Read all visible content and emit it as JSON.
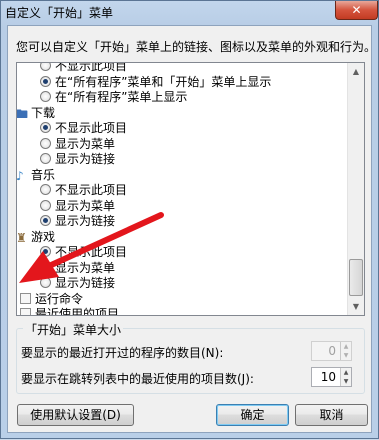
{
  "window": {
    "title": "自定义「开始」菜单",
    "close_label": "✕"
  },
  "intro_text": "您可以自定义「开始」菜单上的链接、图标以及菜单的外观和行为。",
  "list": {
    "rows": [
      {
        "kind": "radio",
        "label": "不显示此项目",
        "checked": false
      },
      {
        "kind": "radio",
        "label": "在“所有程序”菜单和「开始」菜单上显示",
        "checked": true
      },
      {
        "kind": "radio",
        "label": "在“所有程序”菜单上显示",
        "checked": false
      },
      {
        "kind": "category",
        "label": "下载",
        "icon": "folder-icon"
      },
      {
        "kind": "radio",
        "label": "不显示此项目",
        "checked": true
      },
      {
        "kind": "radio",
        "label": "显示为菜单",
        "checked": false
      },
      {
        "kind": "radio",
        "label": "显示为链接",
        "checked": false
      },
      {
        "kind": "category",
        "label": "音乐",
        "icon": "music-icon"
      },
      {
        "kind": "radio",
        "label": "不显示此项目",
        "checked": false
      },
      {
        "kind": "radio",
        "label": "显示为菜单",
        "checked": false
      },
      {
        "kind": "radio",
        "label": "显示为链接",
        "checked": true
      },
      {
        "kind": "category",
        "label": "游戏",
        "icon": "game-icon"
      },
      {
        "kind": "radio",
        "label": "不显示此项目",
        "checked": true
      },
      {
        "kind": "radio",
        "label": "显示为菜单",
        "checked": false
      },
      {
        "kind": "radio",
        "label": "显示为链接",
        "checked": false
      },
      {
        "kind": "checkbox",
        "label": "运行命令",
        "checked": false
      },
      {
        "kind": "checkbox",
        "label": "最近使用的项目",
        "checked": false
      }
    ]
  },
  "menu_size": {
    "legend": "「开始」菜单大小",
    "recent_programs_label": "要显示的最近打开过的程序的数目(N):",
    "recent_programs_value": "0",
    "jump_list_label": "要显示在跳转列表中的最近使用的项目数(J):",
    "jump_list_value": "10"
  },
  "buttons": {
    "use_default": "使用默认设置(D)",
    "ok": "确定",
    "cancel": "取消"
  },
  "annotation": {
    "arrow_color": "#e3161c"
  }
}
